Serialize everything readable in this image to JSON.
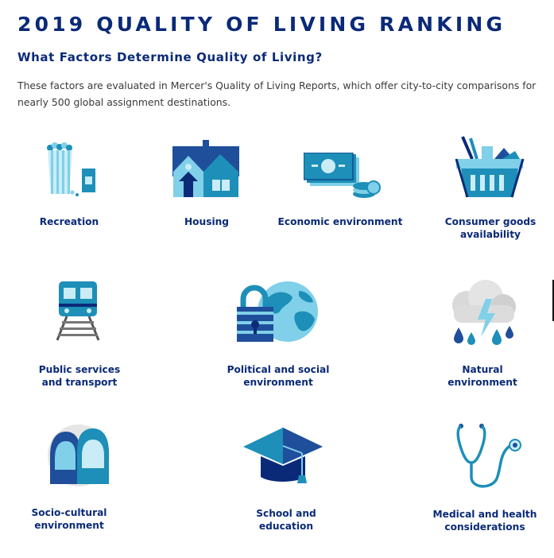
{
  "header": {
    "title": "2019 QUALITY OF LIVING RANKING",
    "subtitle": "What Factors Determine Quality of Living?",
    "intro": "These factors are evaluated in Mercer's Quality of Living Reports, which offer city-to-city comparisons for nearly 500 global assignment destinations."
  },
  "factors": [
    {
      "label": "Recreation",
      "icon": "popcorn-and-drink-icon"
    },
    {
      "label": "Housing",
      "icon": "house-icon"
    },
    {
      "label": "Economic environment",
      "icon": "money-and-coins-icon"
    },
    {
      "label": "Consumer goods\navailability",
      "icon": "shopping-basket-icon"
    },
    {
      "label": "Public services\nand transport",
      "icon": "train-icon"
    },
    {
      "label": "Political and social\nenvironment",
      "icon": "padlock-globe-icon"
    },
    {
      "label": "Natural\nenvironment",
      "icon": "storm-cloud-icon"
    },
    {
      "label": "Socio-cultural\nenvironment",
      "icon": "two-faces-icon"
    },
    {
      "label": "School and\neducation",
      "icon": "graduation-cap-icon"
    },
    {
      "label": "Medical and health\nconsiderations",
      "icon": "stethoscope-icon"
    }
  ],
  "colors": {
    "navy": "#0a2a78",
    "dark_blue": "#1f4f9a",
    "teal": "#1d8fb8",
    "light_blue": "#7fd0e8",
    "pale_blue": "#c9ecf6"
  }
}
